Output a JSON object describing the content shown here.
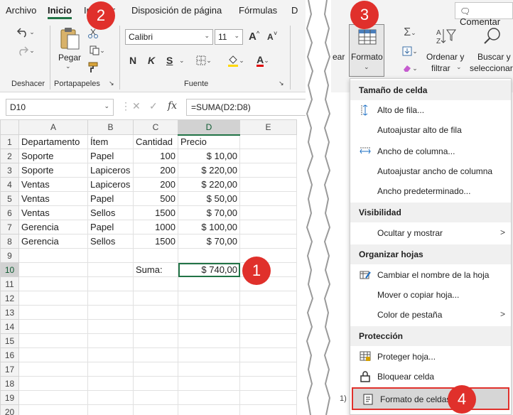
{
  "menu_tabs": [
    "Archivo",
    "Inicio",
    "Insertar",
    "Disposición de página",
    "Fórmulas",
    "D"
  ],
  "groups": {
    "deshacer": "Deshacer",
    "portapapeles": "Portapapeles",
    "fuente": "Fuente"
  },
  "ribbon": {
    "paste": "Pegar",
    "font_name": "Calibri",
    "font_size": "11",
    "font_grow": "A",
    "font_shrink": "A",
    "bold": "N",
    "italic": "K",
    "underline": "S",
    "font_color": "A"
  },
  "formula_bar": {
    "name_box": "D10",
    "fx": "fx",
    "formula": "=SUMA(D2:D8)"
  },
  "columns": [
    "A",
    "B",
    "C",
    "D",
    "E"
  ],
  "rows": [
    [
      "Departamento",
      "Ítem",
      "Cantidad",
      "Precio",
      ""
    ],
    [
      "Soporte",
      "Papel",
      "100",
      "$ 10,00",
      ""
    ],
    [
      "Soporte",
      "Lapiceros",
      "200",
      "$ 220,00",
      ""
    ],
    [
      "Ventas",
      "Lapiceros",
      "200",
      "$ 220,00",
      ""
    ],
    [
      "Ventas",
      "Papel",
      "500",
      "$ 50,00",
      ""
    ],
    [
      "Ventas",
      "Sellos",
      "1500",
      "$ 70,00",
      ""
    ],
    [
      "Gerencia",
      "Papel",
      "1000",
      "$ 100,00",
      ""
    ],
    [
      "Gerencia",
      "Sellos",
      "1500",
      "$ 70,00",
      ""
    ],
    [
      "",
      "",
      "",
      "",
      ""
    ],
    [
      "",
      "",
      "Suma:",
      "$ 740,00",
      ""
    ],
    [
      "",
      "",
      "",
      "",
      ""
    ],
    [
      "",
      "",
      "",
      "",
      ""
    ],
    [
      "",
      "",
      "",
      "",
      ""
    ],
    [
      "",
      "",
      "",
      "",
      ""
    ],
    [
      "",
      "",
      "",
      "",
      ""
    ],
    [
      "",
      "",
      "",
      "",
      ""
    ],
    [
      "",
      "",
      "",
      "",
      ""
    ],
    [
      "",
      "",
      "",
      "",
      ""
    ],
    [
      "",
      "",
      "",
      "",
      ""
    ],
    [
      "",
      "",
      "",
      "",
      ""
    ]
  ],
  "badges": [
    "1",
    "2",
    "3",
    "4"
  ],
  "right": {
    "comment_btn": "Comentar",
    "formato_btn": "Formato",
    "ordenar": [
      "Ordenar y",
      "filtrar"
    ],
    "buscar": [
      "Buscar y",
      "seleccionar"
    ],
    "cut_label": "ear",
    "corner_text": "1)"
  },
  "dropdown": {
    "tamano_title": "Tamaño de celda",
    "alto_fila": "Alto de fila...",
    "autoajustar_alto": "Autoajustar alto de fila",
    "ancho_columna": "Ancho de columna...",
    "autoajustar_ancho": "Autoajustar ancho de columna",
    "ancho_predeterminado": "Ancho predeterminado...",
    "visibilidad_title": "Visibilidad",
    "ocultar": "Ocultar y mostrar",
    "organizar_title": "Organizar hojas",
    "cambiar_nombre": "Cambiar el nombre de la hoja",
    "mover_copiar": "Mover o copiar hoja...",
    "color_pestana": "Color de pestaña",
    "proteccion_title": "Protección",
    "proteger": "Proteger hoja...",
    "bloquear": "Bloquear celda",
    "formato_celdas": "Formato de celdas..."
  },
  "colors": {
    "accent": "#217346",
    "badge": "#e0302b",
    "highlight": "#e0302b"
  }
}
